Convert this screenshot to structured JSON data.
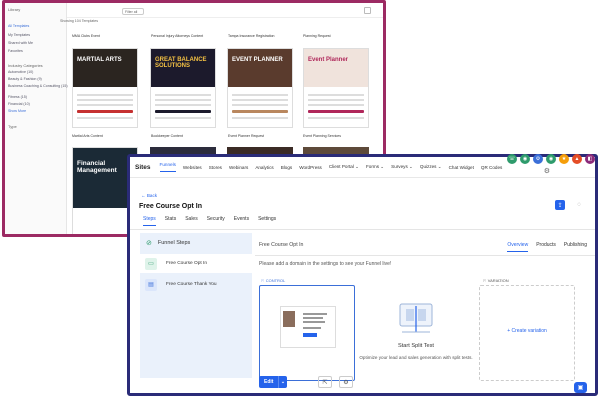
{
  "back_window": {
    "search_value": "Filter all",
    "showing_label": "Showing 104 Templates",
    "sidebar_items": [
      "All Templates",
      "My Templates",
      "Shared with Me",
      "Favorites"
    ],
    "category_label": "Industry Categories",
    "categories": [
      "Automotive (10)",
      "Beauty & Fashion (9)",
      "Business Coaching & Consulting (15)",
      "Fitness (15)",
      "Financial (10)"
    ],
    "show_more": "Show More",
    "type_label": "Type",
    "template_labels": [
      "MMA Clubs Event",
      "Personal Injury Attorneys Content",
      "Tampa Insurance Registration",
      "Planning Request"
    ],
    "template_labels_row2": [
      "Martial Arts Content",
      "Bookkeeper Content",
      "Event Planner Request",
      "Event Planning Services"
    ],
    "hero_texts": [
      "MARTIAL ARTS",
      "GREAT BALANCE SOLUTIONS",
      "EVENT PLANNER",
      "Event Planner",
      "Financial Management"
    ],
    "hero_colors": [
      "#2b2520",
      "#1c1a2c",
      "#5a3b2d",
      "#f0e3dc",
      "#1b2a36"
    ]
  },
  "nav": {
    "brand": "Sites",
    "items": [
      "Funnels",
      "Websites",
      "Stores",
      "Webinars",
      "Analytics",
      "Blogs",
      "WordPress",
      "Client Portal ⌄",
      "Forms ⌄",
      "Surveys ⌄",
      "Quizzes ⌄",
      "Chat Widget",
      "QR Codes"
    ],
    "active_index": 0,
    "top_circle_colors": [
      "#2e9b6c",
      "#2e9b6c",
      "#3b6fd8",
      "#2e9b6c",
      "#f59e0b",
      "#e44d26",
      "#8b2a7a"
    ],
    "top_circle_icons": [
      "☏",
      "◉",
      "⚙",
      "◉",
      "★",
      "▲",
      "◧"
    ]
  },
  "page": {
    "back_link": "← Back",
    "title": "Free Course Opt In",
    "subtabs": [
      "Steps",
      "Stats",
      "Sales",
      "Security",
      "Events",
      "Settings"
    ],
    "active_subtab": 0
  },
  "steps": {
    "heading": "Funnel Steps",
    "items": [
      "Free Course Opt In",
      "Free Course Thank You"
    ]
  },
  "main": {
    "heading": "Free Course Opt In",
    "right_tabs": [
      "Overview",
      "Products",
      "Publishing"
    ],
    "notice": "Please add a domain in the settings to see your Funnel live!",
    "control_label": "CONTROL",
    "variation_label": "VARIATION",
    "create_variation": "+ Create variation",
    "split_title": "Start Split Test",
    "split_sub": "Optimize your lead and sales generation with split tests.",
    "edit_label": "Edit"
  },
  "colors": {
    "accent": "#2563eb",
    "back_border": "#9c2a63",
    "front_border": "#2a2b78",
    "steps_panel": "#eaf1fb"
  }
}
